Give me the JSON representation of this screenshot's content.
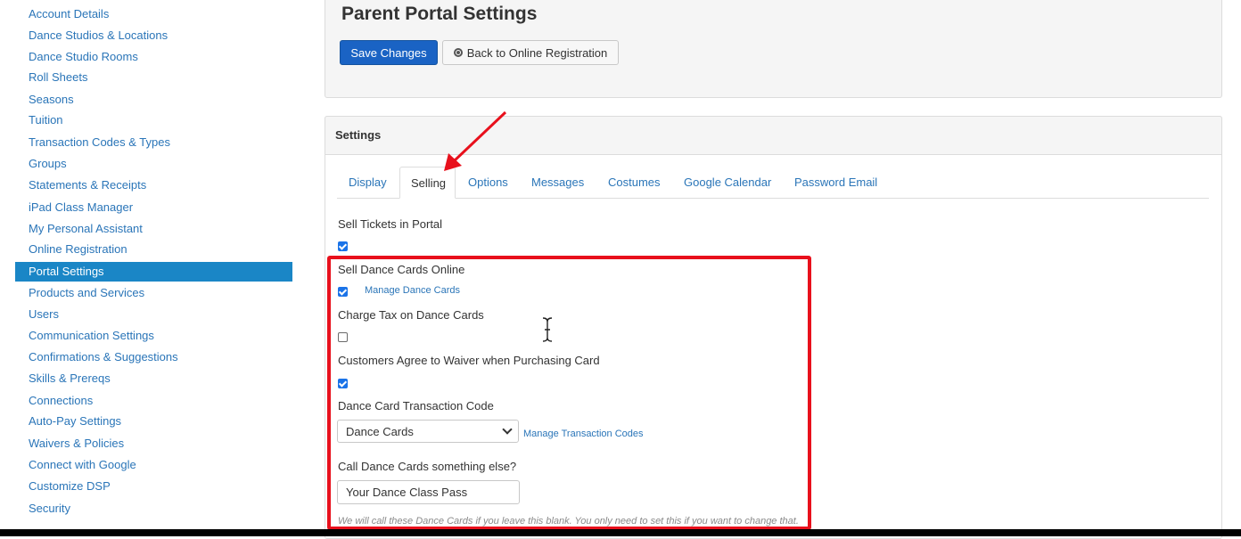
{
  "sidebar": {
    "items": [
      {
        "label": "Account Details"
      },
      {
        "label": "Dance Studios & Locations"
      },
      {
        "label": "Dance Studio Rooms"
      },
      {
        "label": "Roll Sheets"
      },
      {
        "label": "Seasons"
      },
      {
        "label": "Tuition"
      },
      {
        "label": "Transaction Codes & Types"
      },
      {
        "label": "Groups"
      },
      {
        "label": "Statements & Receipts"
      },
      {
        "label": "iPad Class Manager"
      },
      {
        "label": "My Personal Assistant"
      },
      {
        "label": "Online Registration"
      },
      {
        "label": "Portal Settings",
        "active": true
      },
      {
        "label": "Products and Services"
      },
      {
        "label": "Users"
      },
      {
        "label": "Communication Settings"
      },
      {
        "label": "Confirmations & Suggestions"
      },
      {
        "label": "Skills & Prereqs"
      },
      {
        "label": "Connections"
      },
      {
        "label": "Auto-Pay Settings"
      },
      {
        "label": "Waivers & Policies"
      },
      {
        "label": "Connect with Google"
      },
      {
        "label": "Customize DSP"
      },
      {
        "label": "Security"
      }
    ]
  },
  "header": {
    "title": "Parent Portal Settings",
    "save_label": "Save Changes",
    "back_label": "Back to Online Registration",
    "back_icon": "globe-icon"
  },
  "settings": {
    "title": "Settings",
    "tabs": [
      {
        "label": "Display"
      },
      {
        "label": "Selling",
        "active": true
      },
      {
        "label": "Options"
      },
      {
        "label": "Messages"
      },
      {
        "label": "Costumes"
      },
      {
        "label": "Google Calendar"
      },
      {
        "label": "Password Email"
      }
    ],
    "sell_tickets": {
      "label": "Sell Tickets in Portal",
      "checked": true
    },
    "sell_dance_cards": {
      "label": "Sell Dance Cards Online",
      "checked": true,
      "link": "Manage Dance Cards"
    },
    "charge_tax": {
      "label": "Charge Tax on Dance Cards",
      "checked": false
    },
    "waiver": {
      "label": "Customers Agree to Waiver when Purchasing Card",
      "checked": true
    },
    "transaction_code": {
      "label": "Dance Card Transaction Code",
      "value": "Dance Cards",
      "link": "Manage Transaction Codes"
    },
    "rename": {
      "label": "Call Dance Cards something else?",
      "value": "Your Dance Class Pass",
      "help": "We will call these Dance Cards if you leave this blank. You only need to set this if you want to change that."
    }
  },
  "colors": {
    "accent": "#1a86c6",
    "link": "#2a75b8",
    "save_button": "#1a63c4",
    "annotation": "#e8101c"
  }
}
